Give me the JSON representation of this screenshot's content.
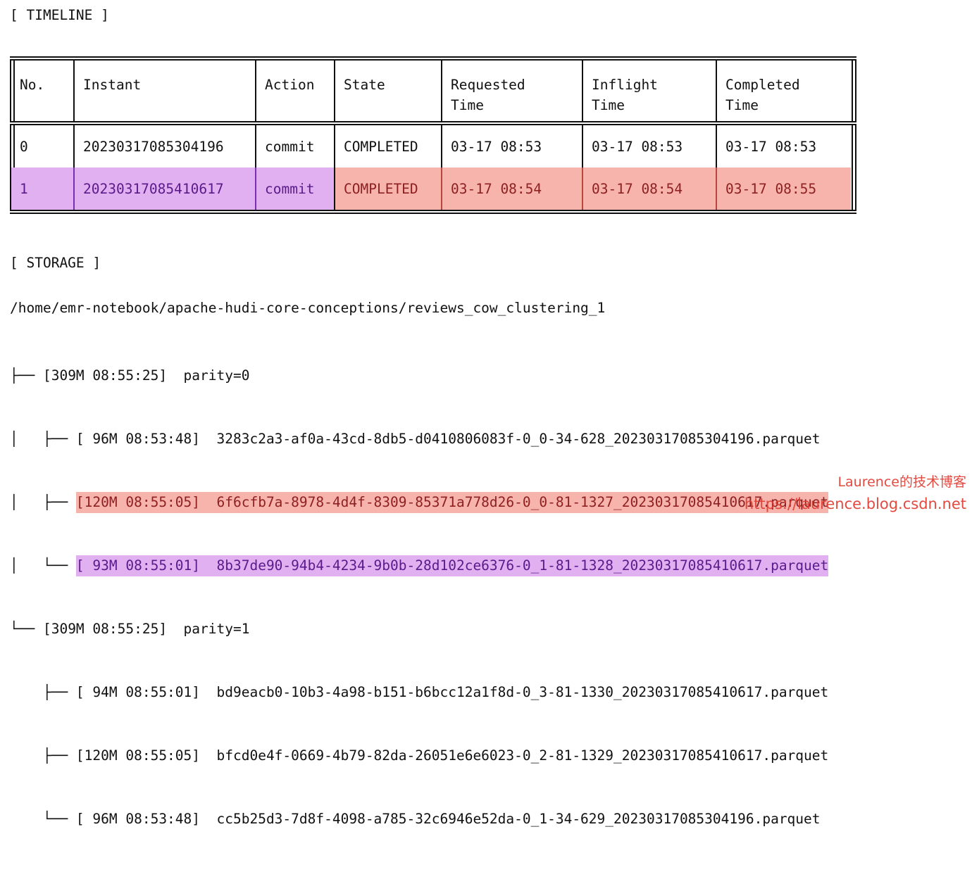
{
  "timeline": {
    "label": "[ TIMELINE ]",
    "columns": [
      "No.",
      "Instant",
      "Action",
      "State",
      "Requested\nTime",
      "Inflight\nTime",
      "Completed\nTime"
    ],
    "columns_flat": {
      "no": "No.",
      "instant": "Instant",
      "action": "Action",
      "state": "State",
      "requested_time_l1": "Requested",
      "requested_time_l2": "Time",
      "inflight_time_l1": "Inflight",
      "inflight_time_l2": "Time",
      "completed_time_l1": "Completed",
      "completed_time_l2": "Time"
    },
    "rows": [
      {
        "no": "0",
        "instant": "20230317085304196",
        "action": "commit",
        "state": "COMPLETED",
        "requested_time": "03-17 08:53",
        "inflight_time": "03-17 08:53",
        "completed_time": "03-17 08:53",
        "highlight": "none"
      },
      {
        "no": "1",
        "instant": "20230317085410617",
        "action": "commit",
        "state": "COMPLETED",
        "requested_time": "03-17 08:54",
        "inflight_time": "03-17 08:54",
        "completed_time": "03-17 08:55",
        "highlight": "purple-then-salmon"
      }
    ]
  },
  "storage": {
    "label": "[ STORAGE ]",
    "root_path": "/home/emr-notebook/apache-hudi-core-conceptions/reviews_cow_clustering_1",
    "tree": [
      {
        "prefix": "├── ",
        "text": "[309M 08:55:25]  parity=0",
        "highlight": "none"
      },
      {
        "prefix": "│   ├── ",
        "text": "[ 96M 08:53:48]  3283c2a3-af0a-43cd-8db5-d0410806083f-0_0-34-628_20230317085304196.parquet",
        "highlight": "none"
      },
      {
        "prefix": "│   ├── ",
        "text": "[120M 08:55:05]  6f6cfb7a-8978-4d4f-8309-85371a778d26-0_0-81-1327_20230317085410617.parquet",
        "highlight": "salmon"
      },
      {
        "prefix": "│   └── ",
        "text": "[ 93M 08:55:01]  8b37de90-94b4-4234-9b0b-28d102ce6376-0_1-81-1328_20230317085410617.parquet",
        "highlight": "purple"
      },
      {
        "prefix": "└── ",
        "text": "[309M 08:55:25]  parity=1",
        "highlight": "none"
      },
      {
        "prefix": "    ├── ",
        "text": "[ 94M 08:55:01]  bd9eacb0-10b3-4a98-b151-b6bcc12a1f8d-0_3-81-1330_20230317085410617.parquet",
        "highlight": "none"
      },
      {
        "prefix": "    ├── ",
        "text": "[120M 08:55:05]  bfcd0e4f-0669-4b79-82da-26051e6e6023-0_2-81-1329_20230317085410617.parquet",
        "highlight": "none"
      },
      {
        "prefix": "    └── ",
        "text": "[ 96M 08:53:48]  cc5b25d3-7d8f-4098-a785-32c6946e52da-0_1-34-629_20230317085304196.parquet",
        "highlight": "none"
      }
    ]
  },
  "watermark": {
    "chinese": "Laurence的技术博客",
    "url": "https://laurence.blog.csdn.net"
  },
  "colors": {
    "purple_bg": "#e1b0f0",
    "purple_fg": "#5b1a8c",
    "salmon_bg": "#f7b4ad",
    "salmon_fg": "#8e2020",
    "text": "#111111",
    "watermark": "#e23a30"
  }
}
